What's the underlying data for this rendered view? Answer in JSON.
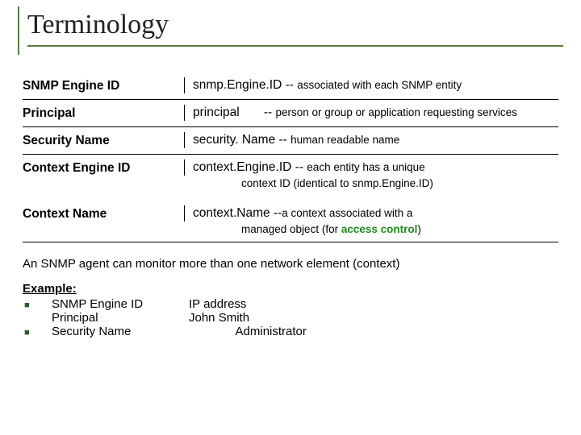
{
  "title": "Terminology",
  "rows": [
    {
      "label": "SNMP Engine ID",
      "var": "snmp.Engine.ID",
      "dashes": " -- ",
      "desc": "associated with each SNMP entity"
    },
    {
      "label": "Principal",
      "var": "principal",
      "dashes": "       -- ",
      "desc": "person or group or application requesting services"
    },
    {
      "label": "Security Name",
      "var": "security. Name",
      "dashes": "  -- ",
      "desc": "human readable name"
    },
    {
      "label": "Context Engine ID",
      "var": "context.Engine.ID",
      "dashes": " -- ",
      "desc": "each entity has a unique",
      "cont": "context ID (identical to  snmp.Engine.ID)"
    },
    {
      "label": "Context Name",
      "var": "context.Name",
      "dashes": " --",
      "desc": "a context associated with a",
      "cont_prefix": "managed object (for ",
      "cont_green": "access control",
      "cont_suffix": ")"
    }
  ],
  "note": "An SNMP agent can monitor more than one network element (context)",
  "example": {
    "title": "Example:",
    "items": [
      {
        "bullet": true,
        "label": "SNMP Engine ID",
        "value": "IP address"
      },
      {
        "bullet": false,
        "label": "Principal",
        "value": "John Smith"
      },
      {
        "bullet": true,
        "label": "Security Name",
        "value": "              Administrator"
      }
    ]
  }
}
